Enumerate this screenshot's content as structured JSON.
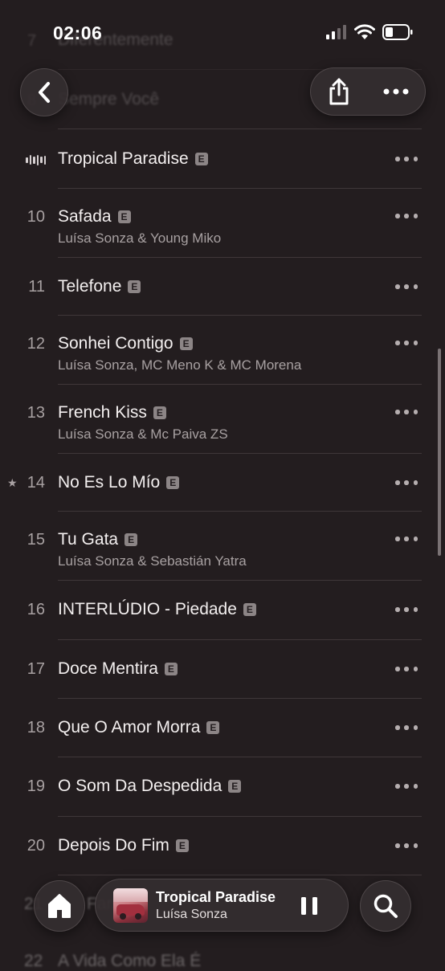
{
  "status_bar": {
    "time": "02:06"
  },
  "faded_rows": [
    {
      "num": "7",
      "title": "Diferentemente"
    },
    {
      "num": "8",
      "title": "Sempre Você"
    }
  ],
  "now_playing_row": {
    "title": "Tropical Paradise",
    "explicit": "E"
  },
  "tracks": [
    {
      "num": "10",
      "title": "Safada",
      "artist": "Luísa Sonza & Young Miko",
      "explicit": "E"
    },
    {
      "num": "11",
      "title": "Telefone",
      "artist": "",
      "explicit": "E"
    },
    {
      "num": "12",
      "title": "Sonhei Contigo",
      "artist": "Luísa Sonza, MC Meno K & MC Morena",
      "explicit": "E"
    },
    {
      "num": "13",
      "title": "French Kiss",
      "artist": "Luísa Sonza & Mc Paiva ZS",
      "explicit": "E"
    },
    {
      "num": "14",
      "title": "No Es Lo Mío",
      "artist": "",
      "explicit": "E",
      "star": "★"
    },
    {
      "num": "15",
      "title": "Tu Gata",
      "artist": "Luísa Sonza & Sebastián Yatra",
      "explicit": "E"
    },
    {
      "num": "16",
      "title": "INTERLÚDIO - Piedade",
      "artist": "",
      "explicit": "E"
    },
    {
      "num": "17",
      "title": "Doce Mentira",
      "artist": "",
      "explicit": "E"
    },
    {
      "num": "18",
      "title": "Que O Amor Morra",
      "artist": "",
      "explicit": "E"
    },
    {
      "num": "19",
      "title": "O Som Da Despedida",
      "artist": "",
      "explicit": "E"
    },
    {
      "num": "20",
      "title": "Depois Do Fim",
      "artist": "",
      "explicit": "E"
    }
  ],
  "under_bar_text": {
    "row21_num": "21",
    "row21_title": "Farsa",
    "row22_num": "22",
    "row22_title": "A Vida Como Ela É"
  },
  "mini_player": {
    "title": "Tropical Paradise",
    "artist": "Luísa Sonza"
  },
  "icons": {
    "back": "chevron-left-icon",
    "share": "share-icon",
    "more": "ellipsis-icon",
    "home": "home-icon",
    "search": "search-icon",
    "pause": "pause-icon",
    "now_playing": "waveform-icon"
  },
  "colors": {
    "background": "#231d1f",
    "text": "#f2eeee",
    "secondary": "#a8a1a2",
    "separator": "#3f3739"
  }
}
